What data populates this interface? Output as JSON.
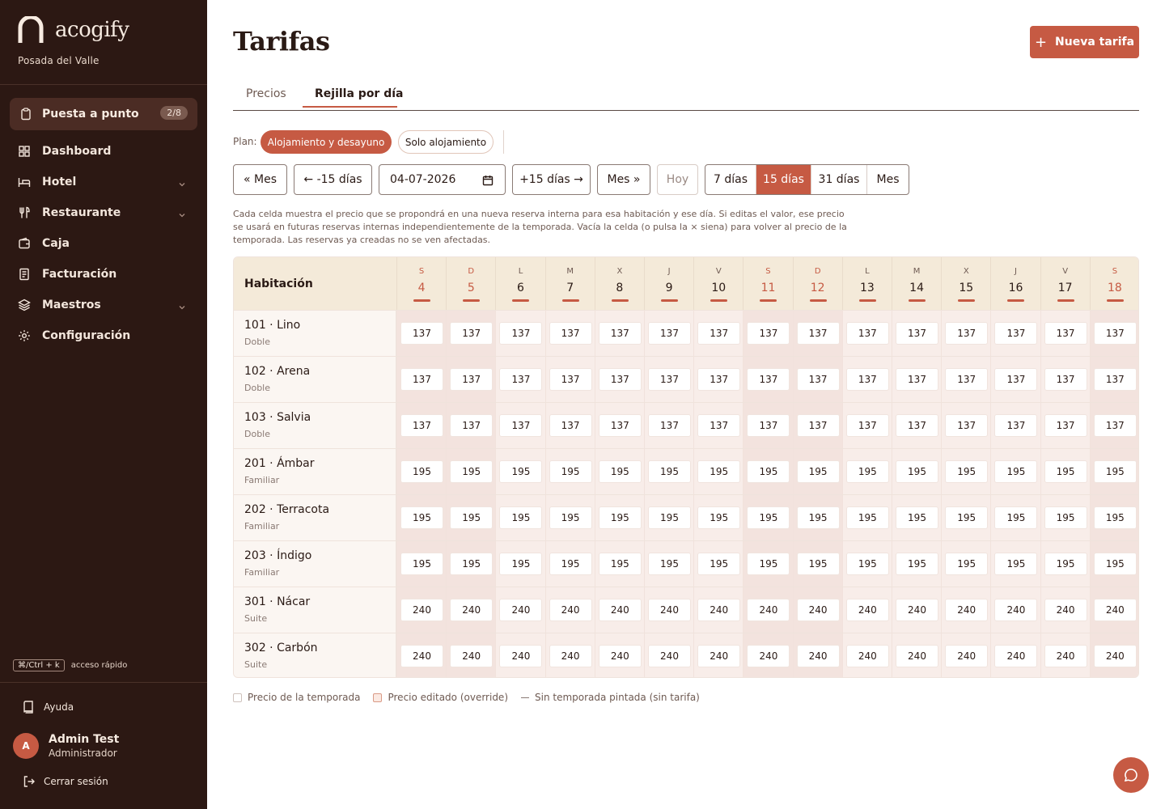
{
  "sidebar": {
    "brand": "acogify",
    "property": "Posada del Valle",
    "setup": {
      "label": "Puesta a punto",
      "badge": "2/8"
    },
    "nav": [
      {
        "label": "Dashboard",
        "icon": "grid-icon"
      },
      {
        "label": "Hotel",
        "icon": "bed-icon",
        "has_chevron": true
      },
      {
        "label": "Restaurante",
        "icon": "utensils-icon",
        "has_chevron": true
      },
      {
        "label": "Caja",
        "icon": "wallet-icon"
      },
      {
        "label": "Facturación",
        "icon": "receipt-icon"
      },
      {
        "label": "Maestros",
        "icon": "layers-icon",
        "has_chevron": true
      },
      {
        "label": "Configuración",
        "icon": "gear-icon"
      }
    ],
    "shortcut_key": "⌘/Ctrl + k",
    "shortcut_text": "acceso rápido",
    "help": "Ayuda",
    "user": {
      "initial": "A",
      "name": "Admin Test",
      "role": "Administrador"
    },
    "logout": "Cerrar sesión"
  },
  "page": {
    "title": "Tarifas",
    "new_button": "Nueva tarifa",
    "tabs": [
      "Precios",
      "Rejilla por día"
    ],
    "active_tab": "Rejilla por día"
  },
  "plan": {
    "label": "Plan:",
    "options": [
      "Alojamiento y desayuno",
      "Solo alojamiento"
    ],
    "selected": "Alojamiento y desayuno"
  },
  "toolbar": {
    "prev_month": "« Mes",
    "prev_15": "← -15 días",
    "date_value": "04-07-2026",
    "next_15": "+15 días →",
    "next_month": "Mes »",
    "today": "Hoy",
    "ranges": [
      "7 días",
      "15 días",
      "31 días",
      "Mes"
    ],
    "selected_range": "15 días"
  },
  "description": "Cada celda muestra el precio que se propondrá en una nueva reserva interna para esa habitación y ese día. Si editas el valor, ese precio se usará en futuras reservas internas independientemente de la temporada. Vacía la celda (o pulsa la × siena) para volver al precio de la temporada. Las reservas ya creadas no se ven afectadas.",
  "grid": {
    "room_header": "Habitación",
    "days": [
      {
        "dow": "S",
        "day": "4",
        "weekend": true
      },
      {
        "dow": "D",
        "day": "5",
        "weekend": true
      },
      {
        "dow": "L",
        "day": "6"
      },
      {
        "dow": "M",
        "day": "7"
      },
      {
        "dow": "X",
        "day": "8"
      },
      {
        "dow": "J",
        "day": "9"
      },
      {
        "dow": "V",
        "day": "10"
      },
      {
        "dow": "S",
        "day": "11",
        "weekend": true
      },
      {
        "dow": "D",
        "day": "12",
        "weekend": true
      },
      {
        "dow": "L",
        "day": "13"
      },
      {
        "dow": "M",
        "day": "14"
      },
      {
        "dow": "X",
        "day": "15"
      },
      {
        "dow": "J",
        "day": "16"
      },
      {
        "dow": "V",
        "day": "17"
      },
      {
        "dow": "S",
        "day": "18",
        "weekend": true
      }
    ],
    "rooms": [
      {
        "name": "101 · Lino",
        "type": "Doble",
        "price": "137"
      },
      {
        "name": "102 · Arena",
        "type": "Doble",
        "price": "137"
      },
      {
        "name": "103 · Salvia",
        "type": "Doble",
        "price": "137"
      },
      {
        "name": "201 · Ámbar",
        "type": "Familiar",
        "price": "195"
      },
      {
        "name": "202 · Terracota",
        "type": "Familiar",
        "price": "195"
      },
      {
        "name": "203 · Índigo",
        "type": "Familiar",
        "price": "195"
      },
      {
        "name": "301 · Nácar",
        "type": "Suite",
        "price": "240"
      },
      {
        "name": "302 · Carbón",
        "type": "Suite",
        "price": "240"
      }
    ]
  },
  "legend": {
    "season": "Precio de la temporada",
    "override": "Precio editado (override)",
    "none": "Sin temporada pintada (sin tarifa)"
  },
  "colors": {
    "accent": "#c65a43",
    "sidebar": "#2c1813",
    "header": "#f4ead9"
  }
}
